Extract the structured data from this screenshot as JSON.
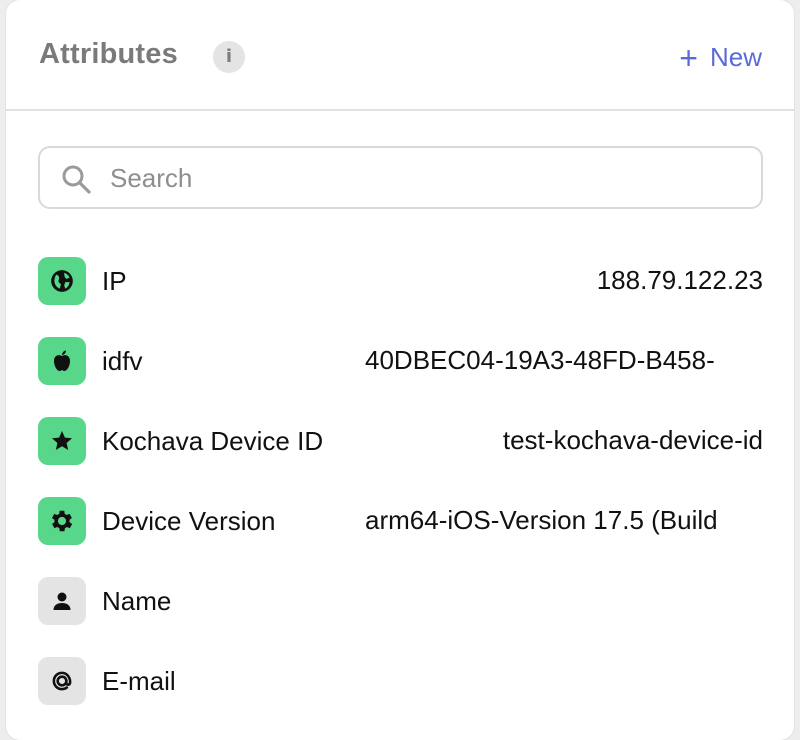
{
  "header": {
    "title": "Attributes",
    "info_glyph": "i",
    "new_label": "New",
    "new_glyph": "+",
    "accent_color": "#5b6bd6"
  },
  "search": {
    "placeholder": "Search",
    "value": ""
  },
  "attributes": [
    {
      "icon": "globe-icon",
      "label": "IP",
      "value": "188.79.122.23",
      "badge": "green"
    },
    {
      "icon": "apple-icon",
      "label": "idfv",
      "value": "40DBEC04-19A3-48FD-B458-",
      "badge": "green"
    },
    {
      "icon": "star-icon",
      "label": "Kochava Device ID",
      "value": "test-kochava-device-id",
      "badge": "green"
    },
    {
      "icon": "gear-icon",
      "label": "Device Version",
      "value": "arm64-iOS-Version 17.5 (Build",
      "badge": "green"
    },
    {
      "icon": "person-icon",
      "label": "Name",
      "value": "",
      "badge": "gray"
    },
    {
      "icon": "at-sign-icon",
      "label": "E-mail",
      "value": "",
      "badge": "gray"
    }
  ],
  "colors": {
    "badge_green": "#58d68a",
    "badge_gray": "#e4e4e4"
  }
}
